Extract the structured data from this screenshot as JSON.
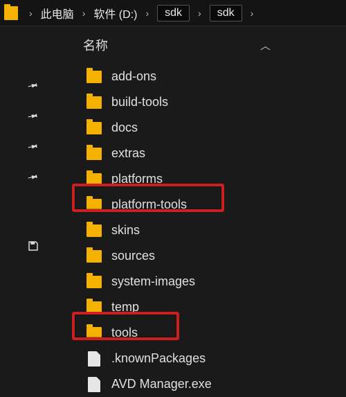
{
  "breadcrumb": {
    "items": [
      "此电脑",
      "软件 (D:)",
      "sdk",
      "sdk"
    ],
    "highlighted_indices": [
      2,
      3
    ]
  },
  "column_header": {
    "label": "名称",
    "sort": "asc"
  },
  "quick_access": {
    "pin_count": 4
  },
  "items": [
    {
      "name": "add-ons",
      "type": "folder"
    },
    {
      "name": "build-tools",
      "type": "folder"
    },
    {
      "name": "docs",
      "type": "folder"
    },
    {
      "name": "extras",
      "type": "folder"
    },
    {
      "name": "platforms",
      "type": "folder"
    },
    {
      "name": "platform-tools",
      "type": "folder",
      "marked": true
    },
    {
      "name": "skins",
      "type": "folder"
    },
    {
      "name": "sources",
      "type": "folder"
    },
    {
      "name": "system-images",
      "type": "folder"
    },
    {
      "name": "temp",
      "type": "folder"
    },
    {
      "name": "tools",
      "type": "folder",
      "marked": true
    },
    {
      "name": ".knownPackages",
      "type": "file"
    },
    {
      "name": "AVD Manager.exe",
      "type": "file"
    }
  ],
  "colors": {
    "folder": "#f5b100",
    "mark": "#cc2020",
    "bg": "#1a1a1a"
  }
}
